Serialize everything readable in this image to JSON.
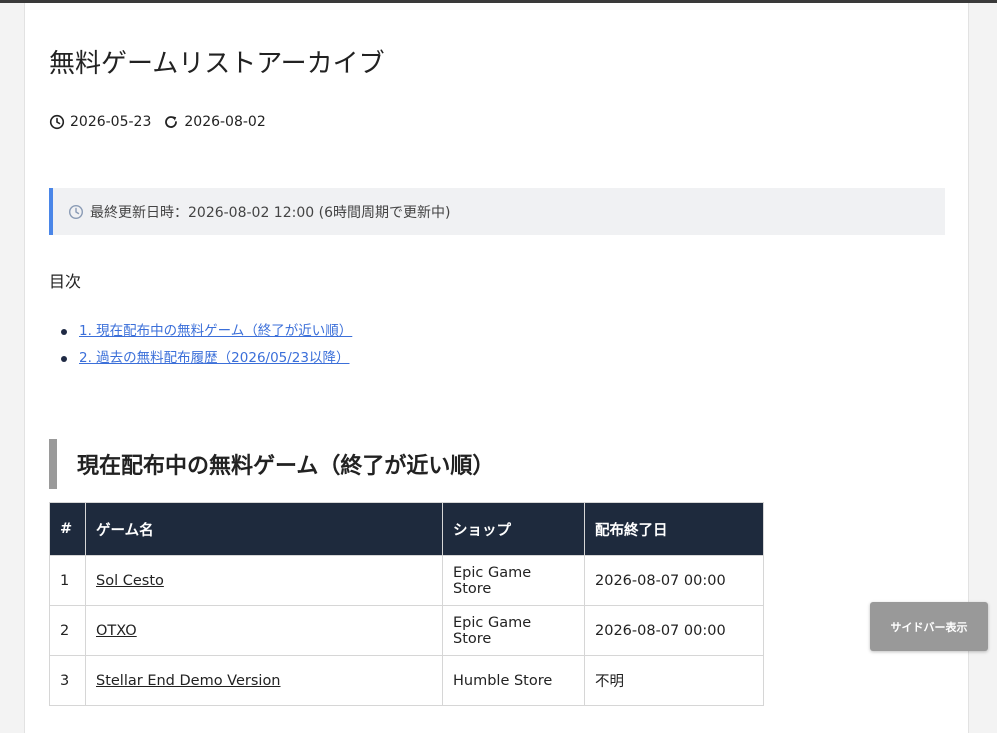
{
  "page": {
    "title": "無料ゲームリストアーカイブ",
    "published_date": "2026-05-23",
    "updated_date": "2026-08-02"
  },
  "notice": {
    "text": "最終更新日時：2026-08-02 12:00 (6時間周期で更新中)"
  },
  "toc": {
    "title": "目次",
    "items": [
      {
        "label": "1. 現在配布中の無料ゲーム（終了が近い順）"
      },
      {
        "label": "2. 過去の無料配布履歴（2026/05/23以降）"
      }
    ]
  },
  "section": {
    "heading": "現在配布中の無料ゲーム（終了が近い順）"
  },
  "table": {
    "headers": [
      "#",
      "ゲーム名",
      "ショップ",
      "配布終了日"
    ],
    "rows": [
      {
        "num": "1",
        "name": "Sol Cesto",
        "shop": "Epic Game Store",
        "end": "2026-08-07 00:00"
      },
      {
        "num": "2",
        "name": "OTXO",
        "shop": "Epic Game Store",
        "end": "2026-08-07 00:00"
      },
      {
        "num": "3",
        "name": "Stellar End Demo Version",
        "shop": "Humble Store",
        "end": "不明"
      }
    ]
  },
  "sidebar_button": {
    "label": "サイドバー表示"
  },
  "colors": {
    "accent": "#4a86e8",
    "table_header": "#1e2a3d",
    "link": "#3b6fd9",
    "heading_bar": "#9a9a9a"
  }
}
